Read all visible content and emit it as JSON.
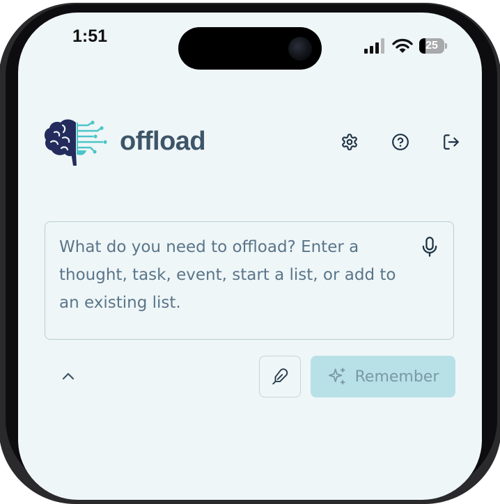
{
  "status_bar": {
    "time": "1:51",
    "battery_percent": 25,
    "battery_label": "25",
    "icons": [
      "cellular-signal-icon",
      "wifi-icon",
      "battery-icon"
    ]
  },
  "header": {
    "app_name": "offload",
    "logo_icon": "brain-circuit-logo",
    "actions": [
      "settings-gear-icon",
      "help-question-icon",
      "logout-icon"
    ]
  },
  "input": {
    "placeholder": "What do you need to offload? Enter a thought, task, event, start a list, or add to an existing list.",
    "value": "",
    "mic_icon": "microphone-icon"
  },
  "actions": {
    "collapse_icon": "chevron-up-icon",
    "handwriting_icon": "pen-icon",
    "remember_icon": "sparkle-icon",
    "remember_label": "Remember"
  },
  "colors": {
    "screen_bg": "#eff6f8",
    "brand_text": "#3d5568",
    "brand_dark": "#232c5c",
    "brand_teal": "#4cc5c8",
    "input_text": "#5a7589",
    "input_border": "#b6cdd1",
    "remember_bg": "#b8e1e7",
    "remember_text": "#7a98a5"
  }
}
